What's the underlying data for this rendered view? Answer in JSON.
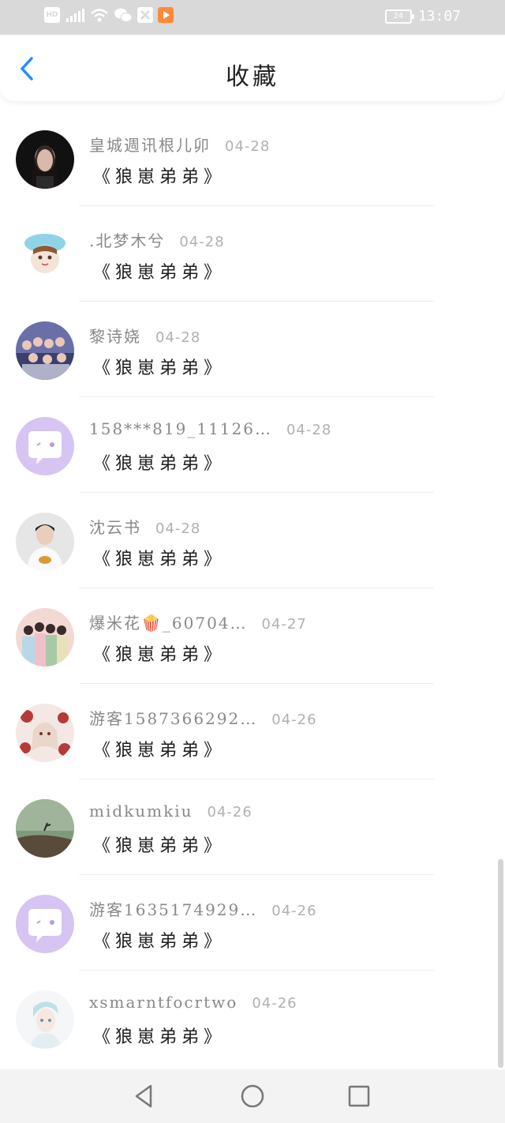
{
  "status_bar": {
    "left_icons": [
      "hd-icon",
      "5g-signal-icon",
      "wifi-icon",
      "wechat-icon",
      "app-x-icon",
      "app-play-icon"
    ],
    "hd_label": "HD",
    "battery": "24",
    "time": "13:07"
  },
  "header": {
    "title": "收藏",
    "back_icon": "chevron-left-icon",
    "accent_color": "#1e90ff"
  },
  "items": [
    {
      "username": "皇城週讯根儿卯",
      "date": "04-28",
      "content": "《狼崽弟弟》",
      "avatar": "dark-portrait-avatar"
    },
    {
      "username": ".北梦木兮",
      "date": "04-28",
      "content": "《狼崽弟弟》",
      "avatar": "cartoon-avatar"
    },
    {
      "username": "黎诗娆",
      "date": "04-28",
      "content": "《狼崽弟弟》",
      "avatar": "group-photo-avatar"
    },
    {
      "username": "158***819_11126…",
      "date": "04-28",
      "content": "《狼崽弟弟》",
      "avatar": "default-chat-avatar"
    },
    {
      "username": "沈云书",
      "date": "04-28",
      "content": "《狼崽弟弟》",
      "avatar": "boy-portrait-avatar"
    },
    {
      "username": "爆米花🍿_60704…",
      "date": "04-27",
      "content": "《狼崽弟弟》",
      "avatar": "group-photo-avatar"
    },
    {
      "username": "游客1587366292…",
      "date": "04-26",
      "content": "《狼崽弟弟》",
      "avatar": "anime-illustration-avatar"
    },
    {
      "username": "midkumkiu",
      "date": "04-26",
      "content": "《狼崽弟弟》",
      "avatar": "landscape-avatar"
    },
    {
      "username": "游客1635174929…",
      "date": "04-26",
      "content": "《狼崽弟弟》",
      "avatar": "default-chat-avatar"
    },
    {
      "username": "xsmarntfocrtwo",
      "date": "04-26",
      "content": "《狼崽弟弟》",
      "avatar": "anime-boy-avatar"
    }
  ],
  "nav_bar": {
    "buttons": [
      "back-triangle-icon",
      "home-circle-icon",
      "recents-square-icon"
    ]
  }
}
